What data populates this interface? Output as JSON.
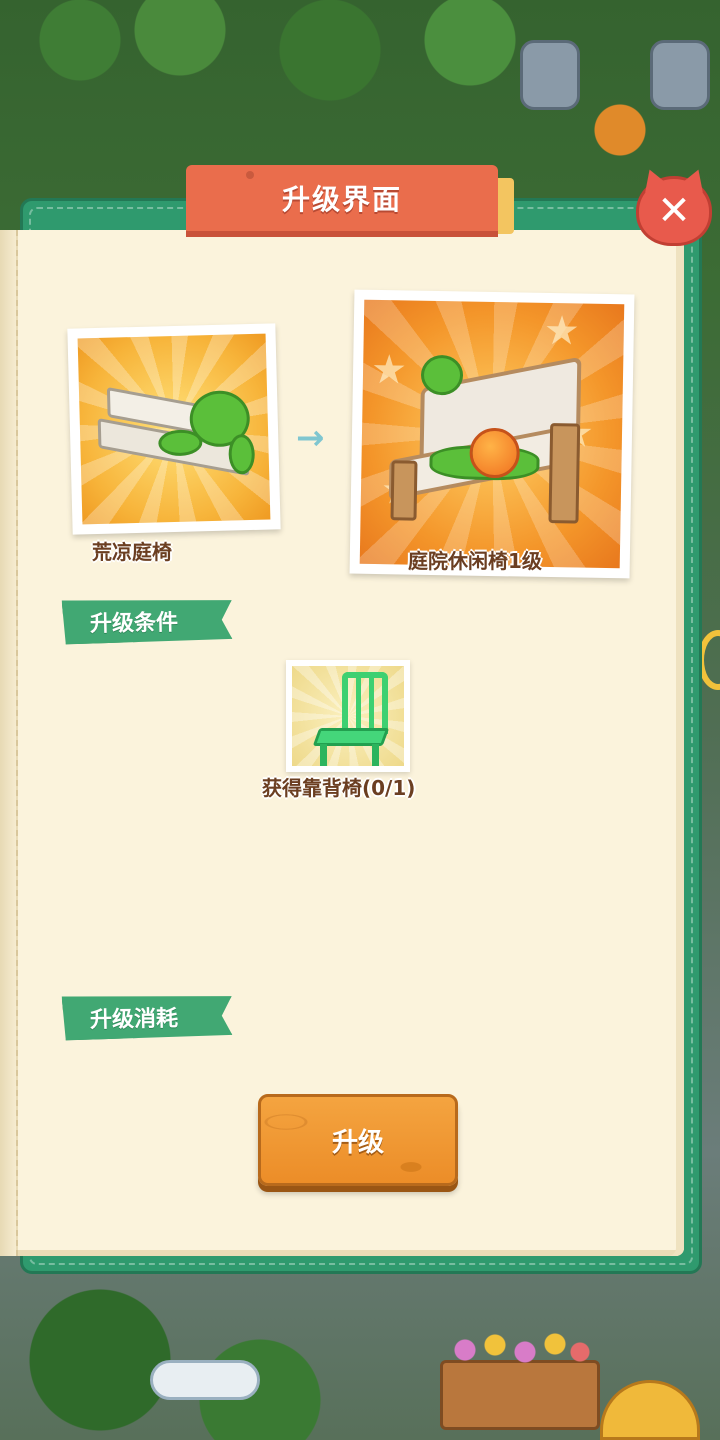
{
  "panel": {
    "title": "升级界面",
    "close_icon": "✕"
  },
  "current_item": {
    "name": "荒凉庭椅",
    "icon": "stone-bench-icon"
  },
  "next_item": {
    "name": "庭院休闲椅1级",
    "icon": "wooden-bench-icon"
  },
  "arrow": "→",
  "conditions": {
    "heading": "升级条件",
    "items": [
      {
        "label": "获得靠背椅(0/1)",
        "icon": "green-chair-icon"
      }
    ]
  },
  "cost": {
    "heading": "升级消耗"
  },
  "upgrade_button": {
    "label": "升级"
  },
  "colors": {
    "frame": "#2f9a6e",
    "banner": "#ea6d4c",
    "paper": "#fbf3dc",
    "ribbon": "#41a873",
    "button": "#ec8d28",
    "text": "#6b3e21"
  }
}
